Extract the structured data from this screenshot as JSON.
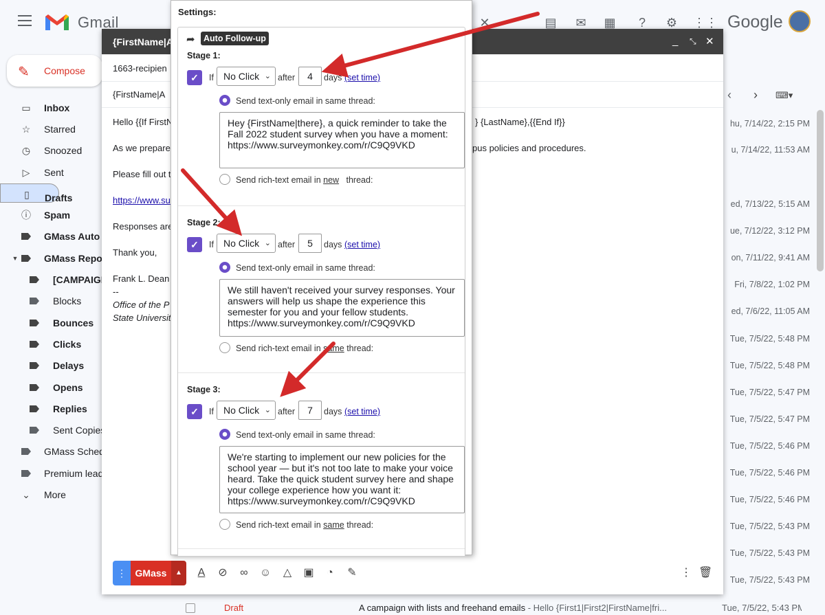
{
  "gmail": {
    "logo_text": "Gmail",
    "brand_right": "Google",
    "compose_label": "Compose",
    "nav": [
      {
        "label": "Inbox",
        "icon": "inbox-icon",
        "bold": true
      },
      {
        "label": "Starred",
        "icon": "star-icon",
        "bold": false
      },
      {
        "label": "Snoozed",
        "icon": "clock-icon",
        "bold": false
      },
      {
        "label": "Sent",
        "icon": "send-icon",
        "bold": false
      },
      {
        "label": "Drafts",
        "icon": "draft-icon",
        "bold": true
      },
      {
        "label": "Spam",
        "icon": "spam-icon",
        "bold": true
      },
      {
        "label": "GMass Auto F",
        "icon": "label-icon",
        "bold": true
      },
      {
        "label": "GMass Repor",
        "icon": "label-icon",
        "bold": true
      },
      {
        "label": "[CAMPAIGN",
        "icon": "label-icon",
        "bold": true
      },
      {
        "label": "Blocks",
        "icon": "label-icon",
        "bold": false
      },
      {
        "label": "Bounces",
        "icon": "label-icon",
        "bold": true
      },
      {
        "label": "Clicks",
        "icon": "label-icon",
        "bold": true
      },
      {
        "label": "Delays",
        "icon": "label-icon",
        "bold": true
      },
      {
        "label": "Opens",
        "icon": "label-icon",
        "bold": true
      },
      {
        "label": "Replies",
        "icon": "label-icon",
        "bold": true
      },
      {
        "label": "Sent Copies",
        "icon": "label-icon",
        "bold": false
      },
      {
        "label": "GMass Sched",
        "icon": "label-icon",
        "bold": false
      },
      {
        "label": "Premium lead",
        "icon": "label-icon",
        "bold": false
      },
      {
        "label": "More",
        "icon": "chevron-down-icon",
        "bold": false
      }
    ],
    "dates": [
      "hu, 7/14/22, 2:15 PM",
      "u, 7/14/22, 11:53 AM",
      "ed, 7/13/22, 5:15 AM",
      "ue, 7/12/22, 3:12 PM",
      "on, 7/11/22, 9:41 AM",
      "Fri, 7/8/22, 1:02 PM",
      "ed, 7/6/22, 11:05 AM",
      "Tue, 7/5/22, 5:48 PM",
      "Tue, 7/5/22, 5:48 PM",
      "Tue, 7/5/22, 5:47 PM",
      "Tue, 7/5/22, 5:47 PM",
      "Tue, 7/5/22, 5:46 PM",
      "Tue, 7/5/22, 5:46 PM",
      "Tue, 7/5/22, 5:46 PM",
      "Tue, 7/5/22, 5:43 PM",
      "Tue, 7/5/22, 5:43 PM",
      "Tue, 7/5/22, 5:43 PM"
    ],
    "draft_row": {
      "label": "Draft",
      "subject": "A campaign with lists and freehand emails",
      "preview": " - Hello {First1|First2|FirstName|fri...",
      "date": "Tue, 7/5/22, 5:43 PM"
    }
  },
  "compose": {
    "title": "{FirstName|A",
    "to": "1663-recipien",
    "subject": "{FirstName|A",
    "body_lines": {
      "greeting_left": "Hello {{If FirstN",
      "greeting_right": "} {LastName},{{End If}}",
      "prepare_left": "As we prepare",
      "prepare_right": "pus policies and procedures.",
      "fill": "Please fill out t",
      "link": "https://www.su",
      "responses": "Responses are",
      "thanks": "Thank you,",
      "name": "Frank L. Dean",
      "dashes": "--",
      "office": "Office of the P",
      "university": "State Universit"
    },
    "send_button": "GMass"
  },
  "settings": {
    "heading": "Settings:",
    "badge": "Auto Follow-up",
    "if_label": "If",
    "after_label": "after",
    "days_label": "days",
    "set_time": "(set time)",
    "text_only_label": "Send text-only email in same thread:",
    "stages": [
      {
        "label": "Stage 1:",
        "condition": "No Click",
        "days": "4",
        "message": "Hey {FirstName|there}, a quick reminder to take the Fall 2022 student survey when you have a moment: https://www.surveymonkey.com/r/C9Q9VKD",
        "rich_prefix": "Send rich-text email in ",
        "rich_word": "new",
        "rich_suffix": "   thread:"
      },
      {
        "label": "Stage 2:",
        "condition": "No Click",
        "days": "5",
        "message": "We still haven't received your survey responses. Your answers will help us shape the experience this semester for you and your fellow students. https://www.surveymonkey.com/r/C9Q9VKD",
        "rich_prefix": "Send rich-text email in ",
        "rich_word": "same",
        "rich_suffix": " thread:"
      },
      {
        "label": "Stage 3:",
        "condition": "No Click",
        "days": "7",
        "message": "We're starting to implement our new policies for the school year — but it's not too late to make your voice heard. Take the quick student survey here and shape your college experience how you want it: https://www.surveymonkey.com/r/C9Q9VKD",
        "rich_prefix": "Send rich-text email in ",
        "rich_word": "same",
        "rich_suffix": " thread:"
      }
    ]
  },
  "colors": {
    "accent": "#6a4dc8",
    "gmass_red": "#d93025",
    "annotation_arrow": "#d32a2a"
  }
}
